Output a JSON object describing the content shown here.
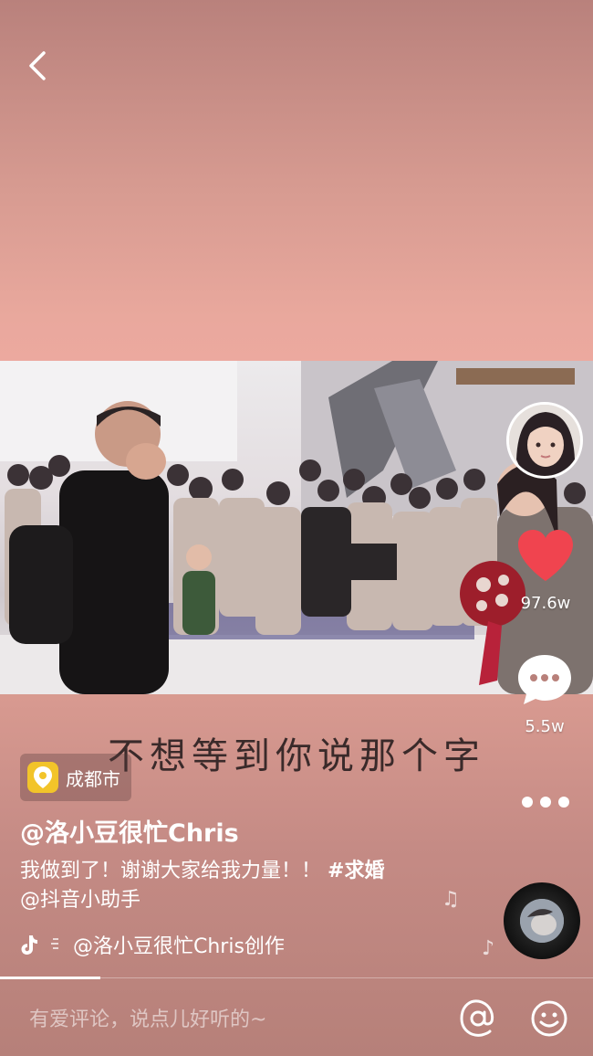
{
  "nav": {
    "back_icon": "chevron-left-icon"
  },
  "video": {
    "lyric": "不想等到你说那个字"
  },
  "sidebar": {
    "likes": "97.6w",
    "comments": "5.5w"
  },
  "location": {
    "label": "成都市",
    "icon": "location-pin-icon"
  },
  "author": "@洛小豆很忙Chris",
  "description": {
    "text": "我做到了！谢谢大家给我力量！！",
    "hashtag": "#求婚",
    "mention": "@抖音小助手"
  },
  "music": {
    "text": "@洛小豆很忙Chris创作",
    "icon": "tiktok-music-icon"
  },
  "comment_bar": {
    "placeholder": "有爱评论，说点儿好听的~"
  },
  "colors": {
    "like": "#f0444f",
    "pin": "#f2c42a"
  }
}
